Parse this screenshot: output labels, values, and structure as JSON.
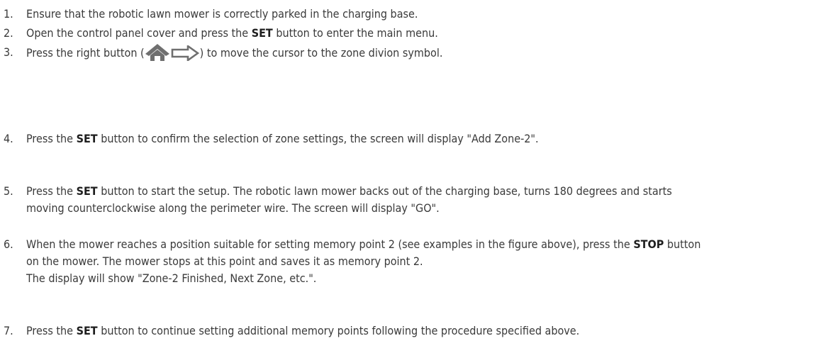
{
  "steps": [
    {
      "number": "1.",
      "text": "Ensure that the robotic lawn mower is correctly parked in the charging base."
    },
    {
      "number": "2.",
      "before": "Open the control panel cover and press the ",
      "bold": "SET",
      "after": " button to enter the main menu."
    },
    {
      "number": "3.",
      "before": "Press the right button (",
      "after": ") to move the cursor to the zone divion symbol.",
      "icons": [
        "home-icon",
        "arrow-right-icon"
      ]
    },
    {
      "number": "4.",
      "before": "Press the ",
      "bold": "SET",
      "after": " button to confirm the selection of zone settings, the screen will display \"Add Zone-2\"."
    },
    {
      "number": "5.",
      "before": "Press the ",
      "bold": "SET",
      "after": " button to start the setup. The robotic lawn mower backs out of the charging base, turns 180 degrees and starts",
      "line2": "moving counterclockwise along the perimeter wire. The screen will display \"GO\"."
    },
    {
      "number": "6.",
      "before": "When the mower reaches a position suitable for setting memory point 2 (see examples in the figure above), press the ",
      "bold": "STOP",
      "after": " button",
      "line2": "on the mower. The mower stops at this point and saves it as memory point 2.",
      "line3": "The display will show \"Zone-2 Finished, Next Zone, etc.\"."
    },
    {
      "number": "7.",
      "before": "Press the ",
      "bold": "SET",
      "after": " button to continue setting additional memory points following the procedure specified above."
    }
  ],
  "colors": {
    "text": "#3a3a3a",
    "icon": "#6f6f6f"
  }
}
